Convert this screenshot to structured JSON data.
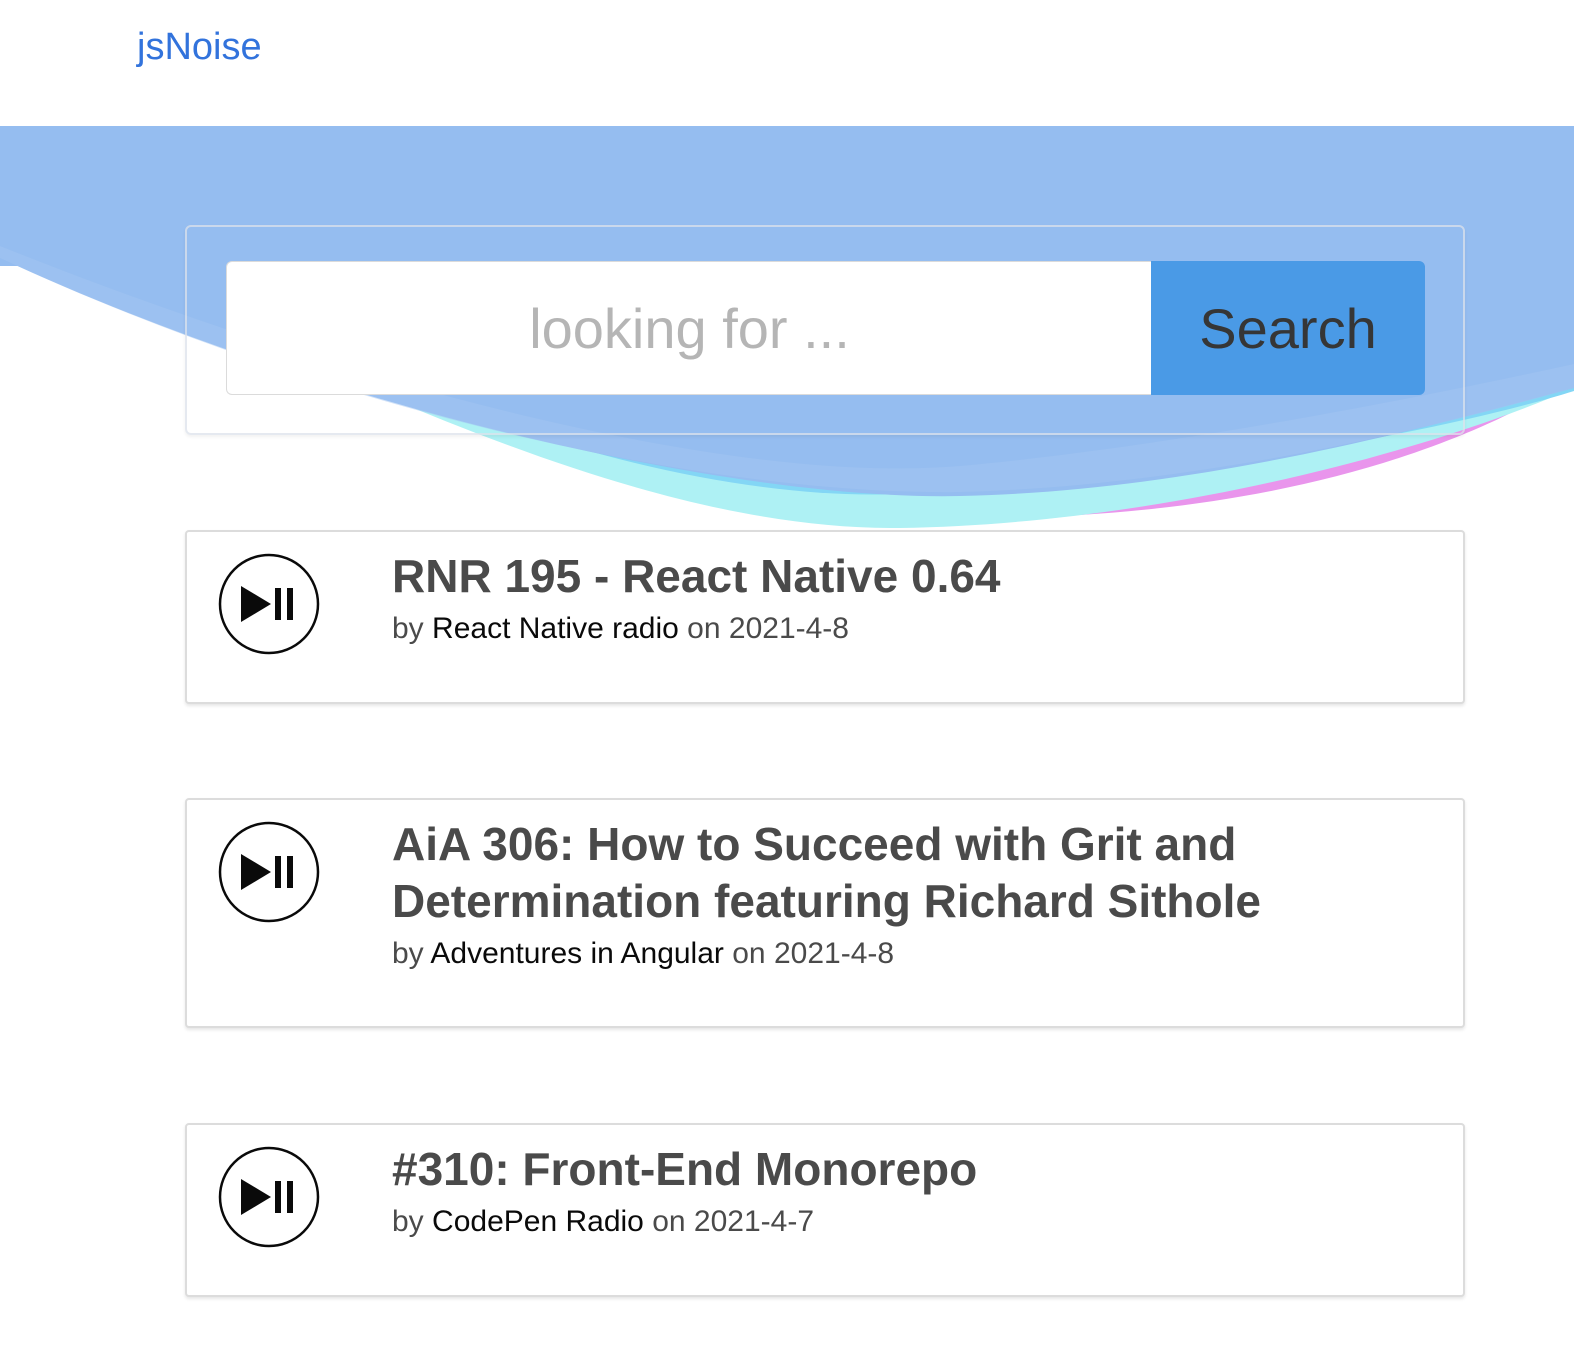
{
  "header": {
    "brand": "jsNoise"
  },
  "search": {
    "placeholder": "looking for ...",
    "value": "",
    "button_label": "Search"
  },
  "episodes": [
    {
      "title": "RNR 195 - React Native 0.64",
      "by_label": "by",
      "podcast": "React Native radio",
      "on_label": "on",
      "date": "2021-4-8"
    },
    {
      "title": "AiA 306: How to Succeed with Grit and Determination featuring Richard Sithole",
      "by_label": "by",
      "podcast": "Adventures in Angular",
      "on_label": "on",
      "date": "2021-4-8"
    },
    {
      "title": "#310: Front-End Monorepo",
      "by_label": "by",
      "podcast": "CodePen Radio",
      "on_label": "on",
      "date": "2021-4-7"
    }
  ],
  "icons": {
    "play_pause": "play-pause-icon"
  },
  "colors": {
    "brand_link": "#3273dc",
    "search_button": "#4a9ae6",
    "hero_blue": "#95bdf0",
    "wave_cyan": "#83d6f5",
    "wave_pink": "#e995ec"
  }
}
